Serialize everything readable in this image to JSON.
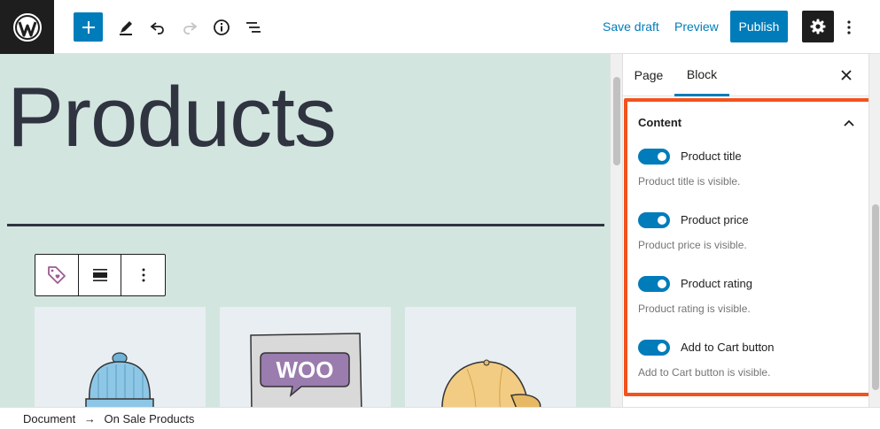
{
  "toolbar": {
    "save_draft": "Save draft",
    "preview": "Preview",
    "publish": "Publish"
  },
  "canvas": {
    "page_title": "Products",
    "product_badges": [
      "WOO"
    ]
  },
  "sidebar": {
    "tabs": [
      {
        "label": "Page",
        "active": false
      },
      {
        "label": "Block",
        "active": true
      }
    ],
    "panel": {
      "title": "Content",
      "toggles": [
        {
          "label": "Product title",
          "help": "Product title is visible.",
          "checked": true
        },
        {
          "label": "Product price",
          "help": "Product price is visible.",
          "checked": true
        },
        {
          "label": "Product rating",
          "help": "Product rating is visible.",
          "checked": true
        },
        {
          "label": "Add to Cart button",
          "help": "Add to Cart button is visible.",
          "checked": true
        }
      ]
    }
  },
  "breadcrumb": {
    "items": [
      "Document",
      "On Sale Products"
    ],
    "separator": "→"
  },
  "colors": {
    "accent": "#007cba",
    "canvas_bg": "#d3e5df",
    "highlight": "#f2521d",
    "dark": "#1e1e1e"
  },
  "icons": {
    "logo": "wordpress-logo-icon",
    "add": "plus-icon",
    "tools": "pencil-icon",
    "undo": "undo-icon",
    "redo": "redo-icon",
    "details": "info-icon",
    "outline": "list-view-icon",
    "settings": "gear-icon",
    "more": "vertical-ellipsis-icon",
    "close": "close-icon",
    "collapse": "chevron-up-icon",
    "block_type": "tag-heart-icon",
    "align": "align-center-icon"
  }
}
